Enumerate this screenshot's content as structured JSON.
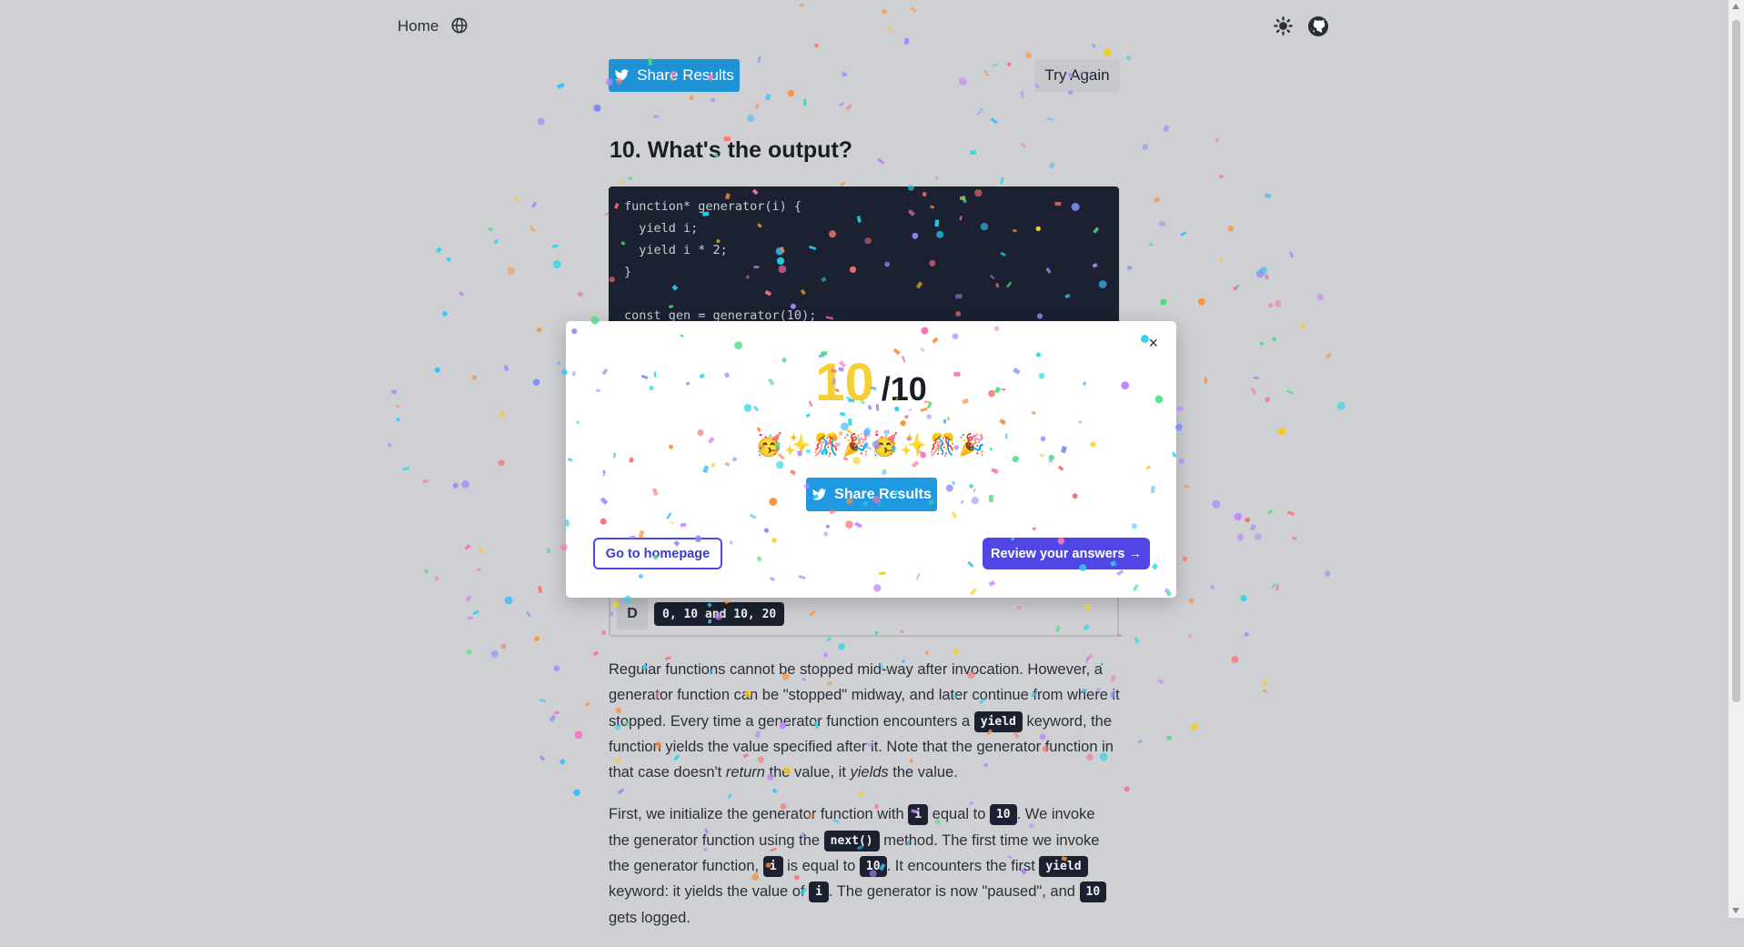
{
  "nav": {
    "home_label": "Home"
  },
  "toolbar": {
    "share_label": "Share Results",
    "try_again_label": "Try Again"
  },
  "question": {
    "title": "10. What's the output?",
    "code_lines": [
      "function* generator(i) {",
      "  yield i;",
      "  yield i * 2;",
      "}",
      "",
      "const gen = generator(10);"
    ]
  },
  "option": {
    "letter": "D",
    "code": "0, 10 and 10, 20"
  },
  "explanation": {
    "p1": {
      "a": "Regular functions cannot be stopped mid-way after invocation. However, a generator function can be \"stopped\" midway, and later continue from where it stopped. Every time a generator function encounters a ",
      "kw": "yield",
      "b": " keyword, the function yields the value specified after it. Note that the generator function in that case doesn't ",
      "em1": "return",
      "c": " the value, it ",
      "em2": "yields",
      "d": " the value."
    },
    "p2": {
      "a": "First, we initialize the generator function with ",
      "k1": "i",
      "b": " equal to ",
      "k2": "10",
      "c": ". We invoke the generator function using the ",
      "k3": "next()",
      "d": " method. The first time we invoke the generator function, ",
      "k4": "i",
      "e": " is equal to ",
      "k5": "10",
      "f": ". It encounters the first ",
      "k6": "yield",
      "g": " keyword: it yields the value of ",
      "k7": "i",
      "h": ". The generator is now \"paused\", and ",
      "k8": "10",
      "i": " gets logged."
    }
  },
  "modal": {
    "score": "10",
    "total": "/10",
    "emojis": "🥳✨🎊🎉🥳✨🎊🎉",
    "share_label": "Share Results",
    "close_label": "×",
    "home_label": "Go to homepage",
    "review_label": "Review your answers →"
  },
  "colors": {
    "background": "#cfd0d4",
    "share_blue": "#1f92d6",
    "accent_indigo": "#4f46e5",
    "score_yellow": "#f3cf39",
    "code_bg": "#1b2130",
    "confetti": [
      "#f472b6",
      "#a78bfa",
      "#38bdf8",
      "#facc15",
      "#4ade80",
      "#fb923c",
      "#f87171",
      "#818cf8",
      "#c084fc",
      "#22d3ee"
    ]
  }
}
